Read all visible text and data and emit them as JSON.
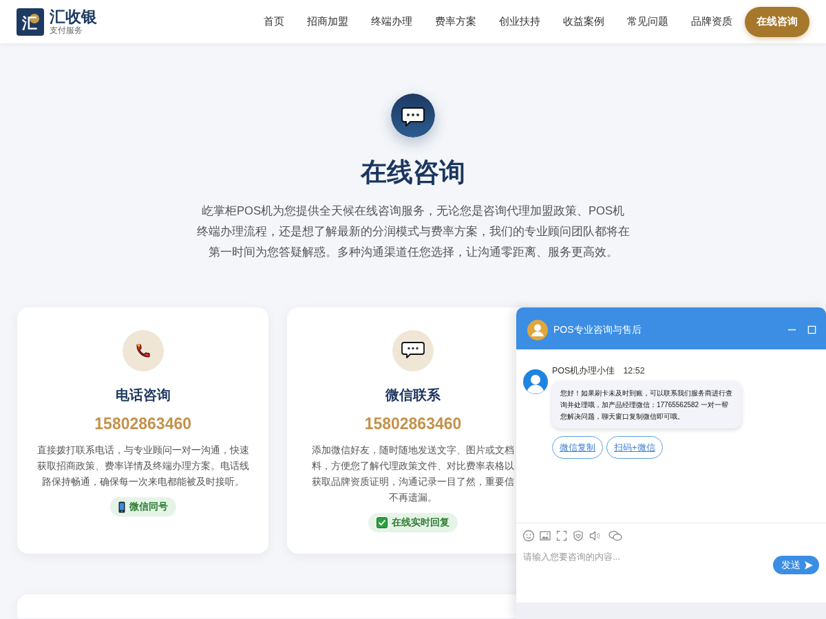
{
  "header": {
    "logo": {
      "mark": "汇",
      "name": "汇收银",
      "tagline": "支付服务"
    },
    "nav": [
      "首页",
      "招商加盟",
      "终端办理",
      "费率方案",
      "创业扶持",
      "收益案例",
      "常见问题",
      "品牌资质"
    ],
    "cta": "在线咨询"
  },
  "hero": {
    "title": "在线咨询",
    "description": "屹掌柜POS机为您提供全天候在线咨询服务，无论您是咨询代理加盟政策、POS机终端办理流程，还是想了解最新的分润模式与费率方案，我们的专业顾问团队都将在第一时间为您答疑解惑。多种沟通渠道任您选择，让沟通零距离、服务更高效。"
  },
  "contact_cards": [
    {
      "kind": "phone",
      "title": "电话咨询",
      "number": "15802863460",
      "description_lines": [
        "直接拨打联系电话，与专业顾问一对一沟通，快速",
        "获取招商政策、费率详情及终端办理方案。电话线",
        "路保持畅通，确保每一次来电都能被及时接听。"
      ],
      "badge": {
        "kind": "mobile",
        "label": "微信同号"
      }
    },
    {
      "kind": "wechat",
      "title": "微信联系",
      "number": "15802863460",
      "description_lines": [
        "添加微信好友，随时随地发送文字、图片或文档",
        "料，方便您了解代理政策文件、对比费率表格以",
        "获取品牌资质证明，沟通记录一目了然，重要信",
        "不再遗漏。"
      ],
      "badge": {
        "kind": "check",
        "label": "在线实时回复"
      }
    }
  ],
  "chat_window": {
    "title": "POS专业咨询与售后",
    "messages": [
      {
        "sender": "POS机办理小佳",
        "time": "12:52",
        "text": "您好！如果刷卡未及时到账，可以联系我们服务商进行查询并处理哦，加产品经理微信：17765562582 一对一帮您解决问题，聊天窗口复制微信即可哦。",
        "actions": [
          "微信复制",
          "扫码+微信"
        ]
      }
    ],
    "input": {
      "placeholder": "请输入您要咨询的内容..."
    },
    "send_label": "发送"
  }
}
